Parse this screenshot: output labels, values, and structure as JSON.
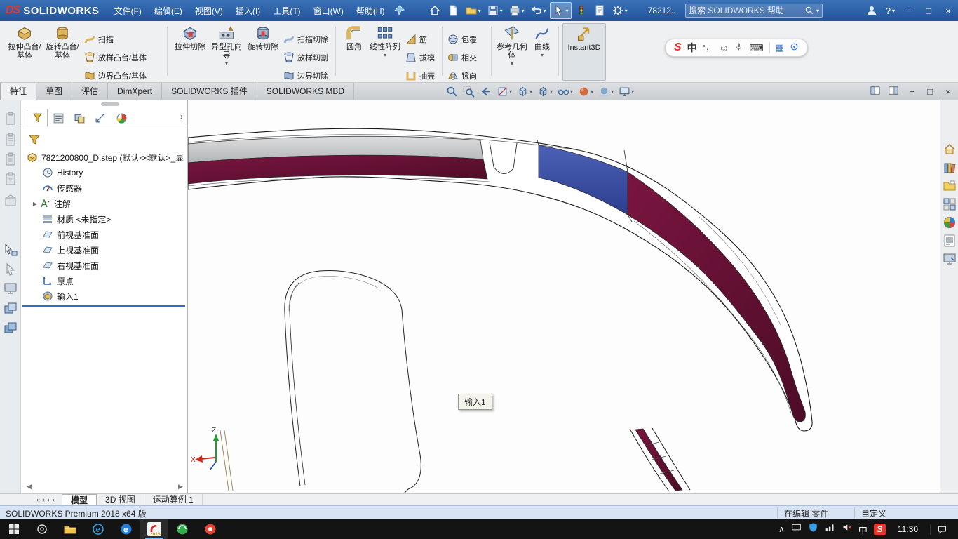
{
  "colors": {
    "titlebar": "#2a5fa7",
    "accent": "#2f6fc4",
    "maroon": "#5e0f31",
    "blue": "#3c4f9f",
    "silver": "#c7c9cb"
  },
  "titlebar": {
    "brand_mark": "DS",
    "brand": "SOLIDWORKS",
    "menus": [
      "文件(F)",
      "编辑(E)",
      "视图(V)",
      "插入(I)",
      "工具(T)",
      "窗口(W)",
      "帮助(H)"
    ],
    "doc_ref": "78212...",
    "search_placeholder": "搜索 SOLIDWORKS 帮助",
    "help": "?"
  },
  "ribbon": {
    "large": [
      "拉伸凸台/基体",
      "旋转凸台/基体",
      "拉伸切除",
      "异型孔向导",
      "旋转切除",
      "圆角",
      "线性阵列",
      "参考几何体",
      "曲线",
      "Instant3D"
    ],
    "small": [
      "扫描",
      "放样凸台/基体",
      "边界凸台/基体",
      "扫描切除",
      "放样切割",
      "边界切除",
      "筋",
      "拔模",
      "抽壳",
      "包覆",
      "相交",
      "镜向"
    ]
  },
  "tabs": [
    "特征",
    "草图",
    "评估",
    "DimXpert",
    "SOLIDWORKS 插件",
    "SOLIDWORKS MBD"
  ],
  "tree": {
    "root": "7821200800_D.step (默认<<默认>_显",
    "items": [
      "History",
      "传感器",
      "注解",
      "材质 <未指定>",
      "前视基准面",
      "上视基准面",
      "右视基准面",
      "原点",
      "输入1"
    ]
  },
  "viewport": {
    "tooltip": "输入1",
    "triad_x": "X",
    "triad_z": "Z"
  },
  "model_tabs": [
    "模型",
    "3D 视图",
    "运动算例 1"
  ],
  "statusbar": {
    "left": "SOLIDWORKS Premium 2018 x64 版",
    "editing": "在编辑 零件",
    "custom": "自定义"
  },
  "taskbar": {
    "time": "11:30",
    "sw_year": "2018"
  },
  "ime": {
    "mark": "S",
    "lang": "中",
    "punct": "°，"
  },
  "tray": {
    "lang": "中",
    "sogou": "S"
  },
  "icons": {
    "dropdown": "▾",
    "expand": "▶",
    "chevron": "›",
    "minimize": "−",
    "maximize": "□",
    "close": "×",
    "nav_first": "«",
    "nav_prev": "‹",
    "nav_next": "›",
    "nav_last": "»",
    "scroll_left": "◀",
    "scroll_right": "▶",
    "caret_up": "∧",
    "smiley": "☺",
    "keyboard": "⌨",
    "grid": "▦",
    "edge_e": "e"
  }
}
